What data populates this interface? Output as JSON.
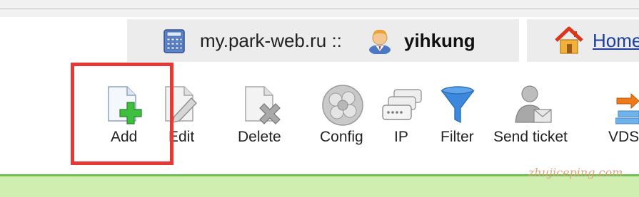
{
  "header": {
    "host": "my.park-web.ru ::",
    "username": "yihkung",
    "home_link": "Home"
  },
  "toolbar": {
    "items": [
      {
        "label": "Add",
        "icon": "add-document-icon"
      },
      {
        "label": "Edit",
        "icon": "edit-document-icon"
      },
      {
        "label": "Delete",
        "icon": "delete-document-icon"
      },
      {
        "label": "Config",
        "icon": "config-icon"
      },
      {
        "label": "IP",
        "icon": "ip-network-icon"
      },
      {
        "label": "Filter",
        "icon": "filter-funnel-icon"
      },
      {
        "label": "Send ticket",
        "icon": "send-ticket-icon"
      },
      {
        "label": "VDS",
        "icon": "vds-icon"
      }
    ]
  },
  "watermark": "zhujiceping.com",
  "colors": {
    "highlight": "#e53935",
    "status_bar": "#cfeeb0",
    "link": "#1c3f9e"
  }
}
